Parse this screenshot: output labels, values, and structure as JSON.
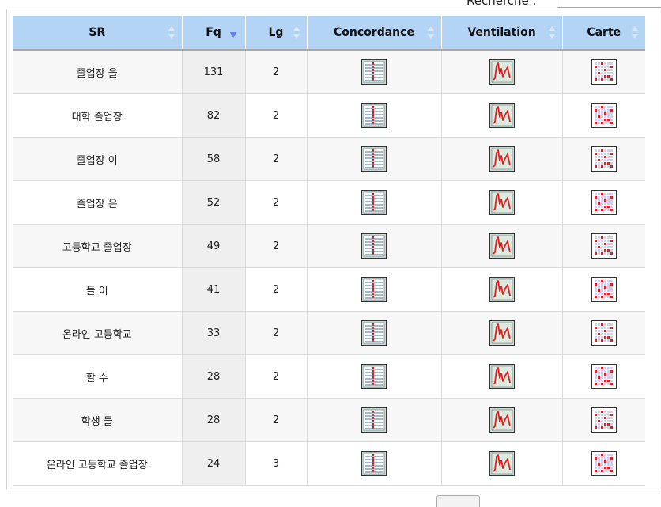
{
  "search": {
    "label": "Recherche :",
    "value": ""
  },
  "columns": [
    {
      "key": "sr",
      "label": "SR"
    },
    {
      "key": "fq",
      "label": "Fq"
    },
    {
      "key": "lg",
      "label": "Lg"
    },
    {
      "key": "concordance",
      "label": "Concordance"
    },
    {
      "key": "ventilation",
      "label": "Ventilation"
    },
    {
      "key": "carte",
      "label": "Carte"
    }
  ],
  "sort": {
    "column": "Fq",
    "direction": "descending"
  },
  "rows": [
    {
      "sr": "졸업장 을",
      "fq": "131",
      "lg": "2"
    },
    {
      "sr": "대학 졸업장",
      "fq": "82",
      "lg": "2"
    },
    {
      "sr": "졸업장 이",
      "fq": "58",
      "lg": "2"
    },
    {
      "sr": "졸업장 은",
      "fq": "52",
      "lg": "2"
    },
    {
      "sr": "고등학교 졸업장",
      "fq": "49",
      "lg": "2"
    },
    {
      "sr": "들 이",
      "fq": "41",
      "lg": "2"
    },
    {
      "sr": "온라인 고등학교",
      "fq": "33",
      "lg": "2"
    },
    {
      "sr": "할 수",
      "fq": "28",
      "lg": "2"
    },
    {
      "sr": "학생 들",
      "fq": "28",
      "lg": "2"
    },
    {
      "sr": "온라인 고등학교 졸업장",
      "fq": "24",
      "lg": "3"
    }
  ],
  "icons": {
    "concordance": "concordance-icon",
    "ventilation": "ventilation-chart-icon",
    "carte": "map-grid-icon"
  },
  "colors": {
    "header": "#b3d4f5",
    "sort_arrow": "#6c7de0",
    "icon_red": "#e02020"
  }
}
